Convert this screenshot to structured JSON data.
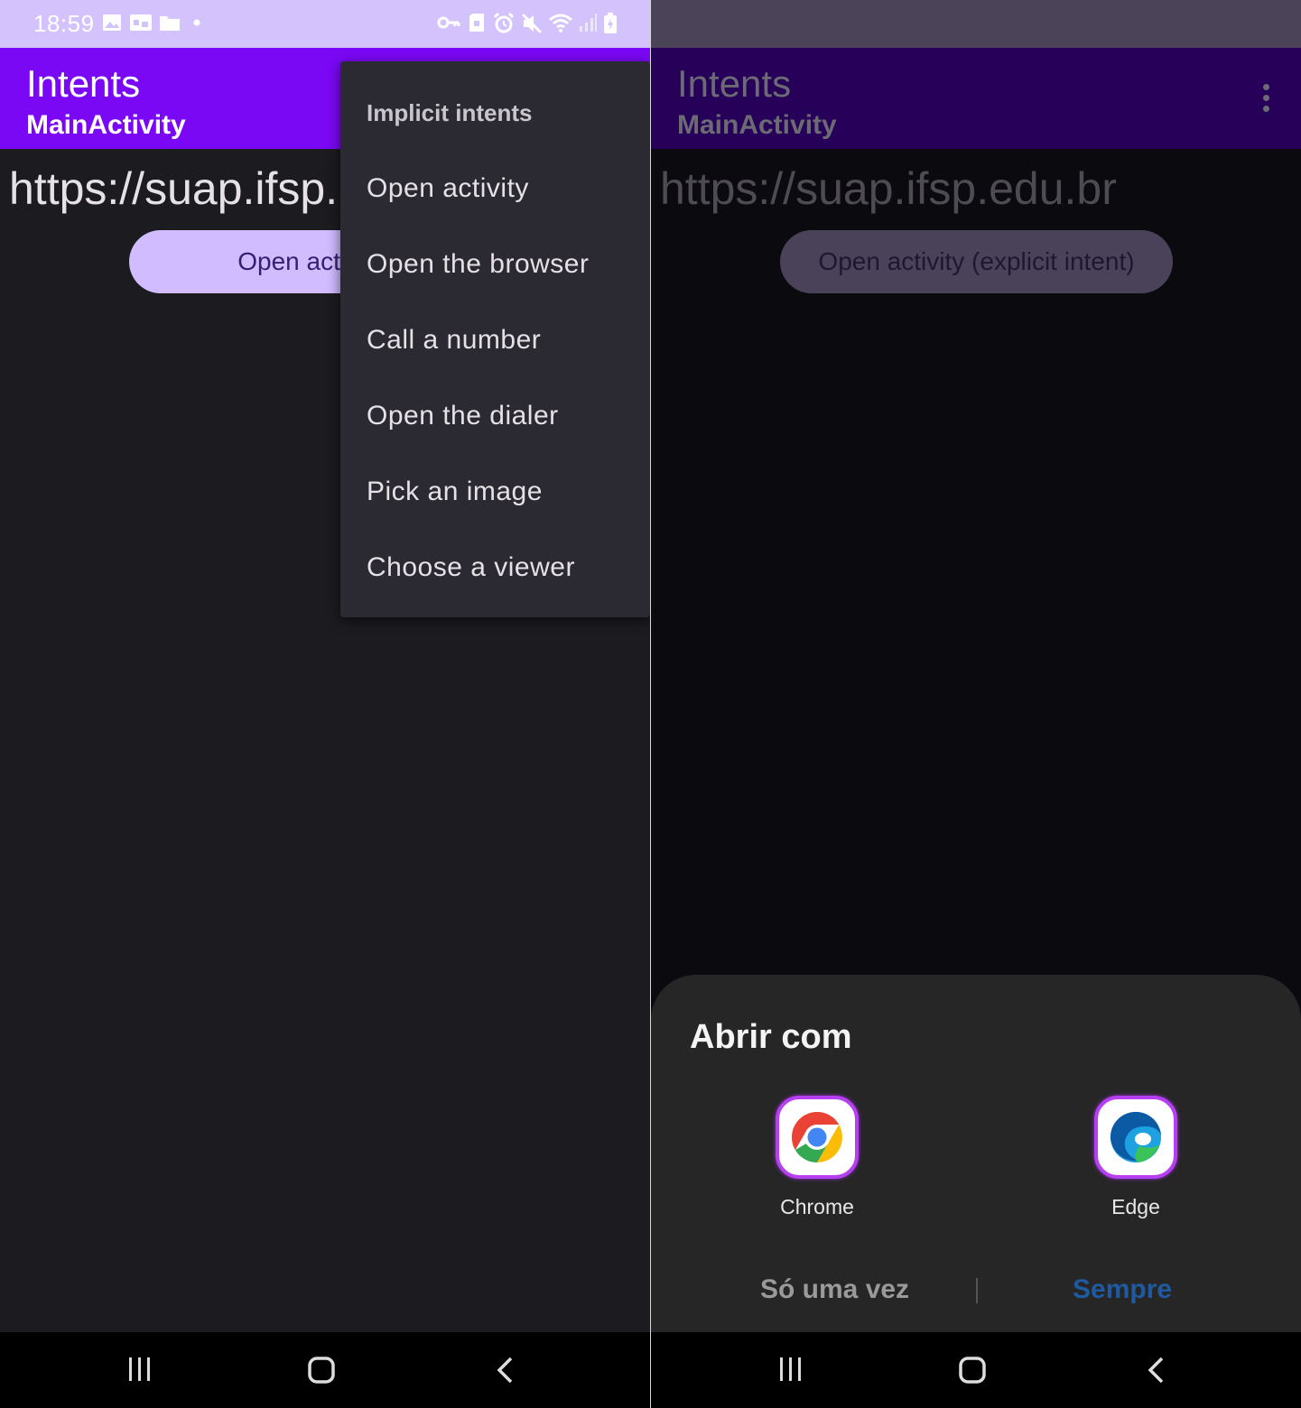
{
  "status_bar": {
    "time": "18:59"
  },
  "app_bar": {
    "title": "Intents",
    "subtitle": "MainActivity"
  },
  "left": {
    "url_text": "https://suap.ifsp.",
    "button_label": "Open activity (e"
  },
  "right": {
    "url_text": "https://suap.ifsp.edu.br",
    "button_label": "Open activity (explicit intent)"
  },
  "menu": {
    "header": "Implicit intents",
    "items": [
      "Open activity",
      "Open the browser",
      "Call a number",
      "Open the dialer",
      "Pick an image",
      "Choose a viewer"
    ]
  },
  "chooser": {
    "title": "Abrir com",
    "apps": [
      {
        "label": "Chrome",
        "icon": "chrome-icon"
      },
      {
        "label": "Edge",
        "icon": "edge-icon"
      }
    ],
    "once_label": "Só uma vez",
    "always_label": "Sempre",
    "always_color": "#1f5aa0",
    "once_color": "#9a9a9a"
  },
  "colors": {
    "primary": "#7b08f5",
    "status_bar": "#d3c2fb",
    "pill": "#d0bcfe",
    "background": "#1c1b20"
  }
}
